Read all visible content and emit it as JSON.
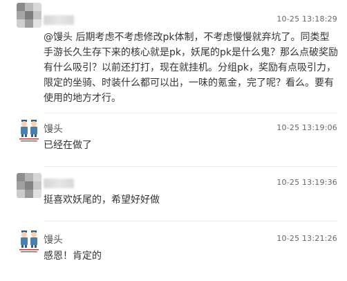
{
  "comments": [
    {
      "user": "",
      "avatar": "blurred-mosaic-avatar",
      "time": "10-25 13:18:29",
      "text": "@馒头 后期考虑不考虑修改pk体制，不考虑慢慢就弃坑了。同类型手游长久生存下来的核心就是pk，妖尾的pk是什么鬼？那么点破奖励有什么吸引？以前还打打，现在就挂机。分组pk，奖励有点吸引力，限定的坐骑、时装什么都可以出，一味的氪金，完了呢？看么。要有使用的地方才行。"
    },
    {
      "user": "馒头",
      "avatar": "cartoon-duo-avatar",
      "time": "10-25 13:19:06",
      "text": "已经在做了"
    },
    {
      "user": "",
      "avatar": "blurred-mosaic-avatar",
      "time": "10-25 13:19:36",
      "text": "挺喜欢妖尾的，希望好好做"
    },
    {
      "user": "馒头",
      "avatar": "cartoon-duo-avatar",
      "time": "10-25 13:21:26",
      "text": "感恩！肯定的"
    }
  ],
  "colors": {
    "text": "#333333",
    "time": "#666666",
    "divider": "#ececec",
    "background": "#ffffff"
  }
}
